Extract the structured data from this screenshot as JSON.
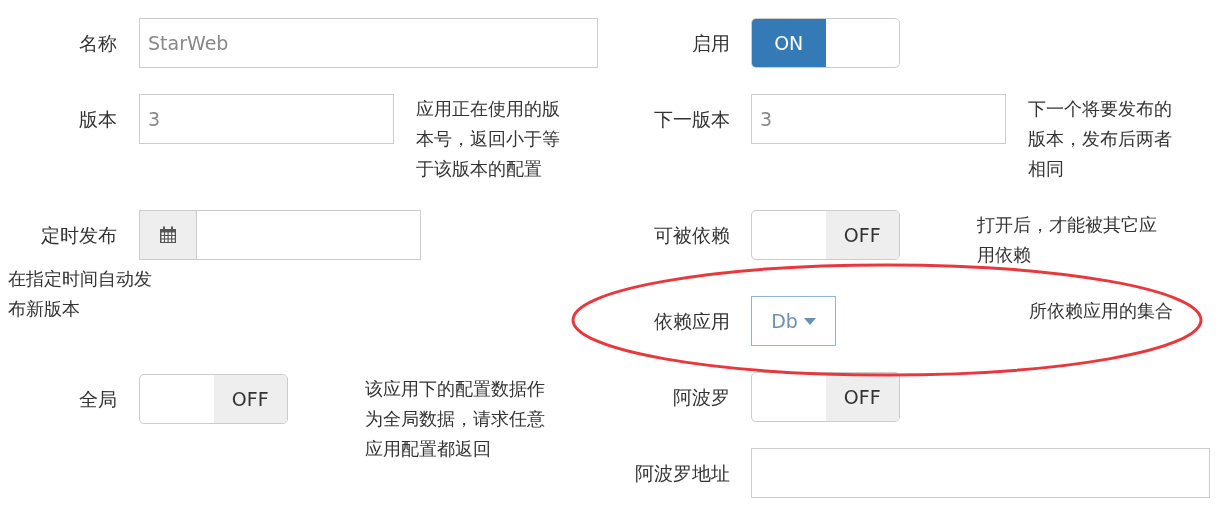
{
  "columns": [
    {
      "rows": [
        {
          "kind": "textfield",
          "label": "名称",
          "value": "StarWeb"
        },
        {
          "kind": "shortfield",
          "label": "版本",
          "value": "3",
          "help": "应用正在使用的版本号，返回小于等于该版本的配置"
        },
        {
          "kind": "date",
          "label": "定时发布",
          "help_below": "在指定时间自动发布新版本"
        },
        {
          "kind": "toggle",
          "label": "全局",
          "on": false,
          "state_text": "OFF",
          "help": "该应用下的配置数据作为全局数据，请求任意应用配置都返回"
        }
      ]
    },
    {
      "rows": [
        {
          "kind": "toggle",
          "label": "启用",
          "on": true,
          "state_text": "ON"
        },
        {
          "kind": "shortfield",
          "label": "下一版本",
          "value": "3",
          "help": "下一个将要发布的版本，发布后两者相同"
        },
        {
          "kind": "toggle",
          "label": "可被依赖",
          "on": false,
          "state_text": "OFF",
          "help": "打开后，才能被其它应用依赖"
        },
        {
          "kind": "select",
          "label": "依赖应用",
          "value": "Db",
          "help": "所依赖应用的集合"
        },
        {
          "kind": "toggle",
          "label": "阿波罗",
          "on": false,
          "state_text": "OFF"
        },
        {
          "kind": "textfield",
          "label": "阿波罗地址"
        }
      ]
    }
  ],
  "annotation": {
    "kind": "ellipse"
  }
}
